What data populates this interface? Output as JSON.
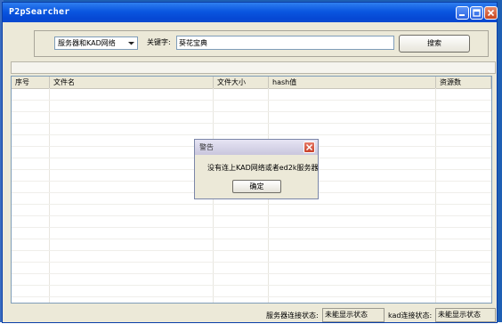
{
  "window": {
    "title": "P2pSearcher"
  },
  "search": {
    "server_select_value": "服务器和KAD网络",
    "keyword_label": "关键字:",
    "keyword_value": "葵花宝典",
    "search_button": "搜索"
  },
  "table": {
    "columns": [
      "序号",
      "文件名",
      "文件大小",
      "hash值",
      "资源数"
    ]
  },
  "dialog": {
    "title": "警告",
    "message": "没有连上KAD网络或者ed2k服务器",
    "ok_label": "确定"
  },
  "status": {
    "server_label": "服务器连接状态:",
    "server_value": "未能显示状态",
    "kad_label": "kad连接状态:",
    "kad_value": "未能显示状态"
  }
}
